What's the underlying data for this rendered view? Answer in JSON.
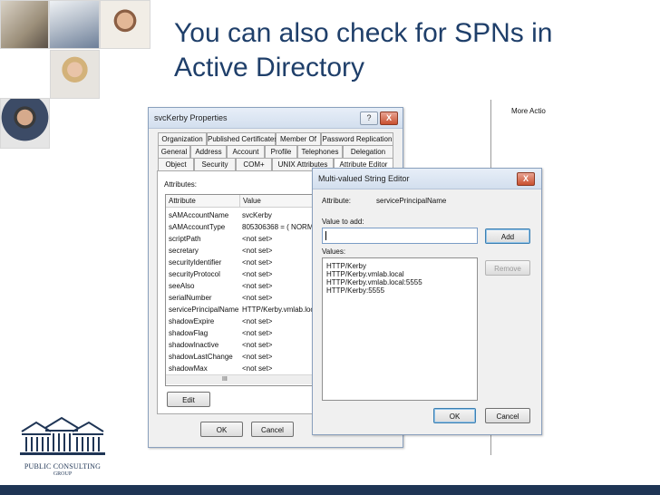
{
  "slide": {
    "title_line1": "You can also check for SPNs in",
    "title_line2": "Active Directory",
    "logo_line1": "PUBLIC CONSULTING",
    "logo_line2": "GROUP"
  },
  "right_panel": {
    "more_actions": "More Actio"
  },
  "properties_dialog": {
    "title": "svcKerby Properties",
    "help_btn": "?",
    "close_btn": "X",
    "tabs_row1": [
      "Organization",
      "Published Certificates",
      "Member Of",
      "Password Replication"
    ],
    "tabs_row2": [
      "General",
      "Address",
      "Account",
      "Profile",
      "Telephones",
      "Delegation"
    ],
    "tabs_row3": [
      "Object",
      "Security",
      "COM+",
      "UNIX Attributes",
      "Attribute Editor"
    ],
    "attributes_label": "Attributes:",
    "col_attribute": "Attribute",
    "col_value": "Value",
    "rows": [
      {
        "attr": "sAMAccountName",
        "value": "svcKerby"
      },
      {
        "attr": "sAMAccountType",
        "value": "805306368 = ( NORMA"
      },
      {
        "attr": "scriptPath",
        "value": "<not set>"
      },
      {
        "attr": "secretary",
        "value": "<not set>"
      },
      {
        "attr": "securityIdentifier",
        "value": "<not set>"
      },
      {
        "attr": "securityProtocol",
        "value": "<not set>"
      },
      {
        "attr": "seeAlso",
        "value": "<not set>"
      },
      {
        "attr": "serialNumber",
        "value": "<not set>"
      },
      {
        "attr": "servicePrincipalName",
        "value": "HTTP/Kerby.vmlab.loca"
      },
      {
        "attr": "shadowExpire",
        "value": "<not set>"
      },
      {
        "attr": "shadowFlag",
        "value": "<not set>"
      },
      {
        "attr": "shadowInactive",
        "value": "<not set>"
      },
      {
        "attr": "shadowLastChange",
        "value": "<not set>"
      },
      {
        "attr": "shadowMax",
        "value": "<not set>"
      }
    ],
    "scroll_grip": "III",
    "edit_btn": "Edit",
    "ok_btn": "OK",
    "cancel_btn": "Cancel"
  },
  "mv_editor": {
    "title": "Multi-valued String Editor",
    "close_btn": "X",
    "attribute_label": "Attribute:",
    "attribute_value": "servicePrincipalName",
    "value_to_add_label": "Value to add:",
    "value_to_add": "",
    "add_btn": "Add",
    "values_label": "Values:",
    "values": [
      "HTTP/Kerby",
      "HTTP/Kerby.vmlab.local",
      "HTTP/Kerby.vmlab.local:5555",
      "HTTP/Kerby:5555"
    ],
    "remove_btn": "Remove",
    "ok_btn": "OK",
    "cancel_btn": "Cancel"
  },
  "colors": {
    "title_text": "#1f3f6a",
    "bottom_bar": "#1f3555",
    "close_button": "#c9502f"
  }
}
